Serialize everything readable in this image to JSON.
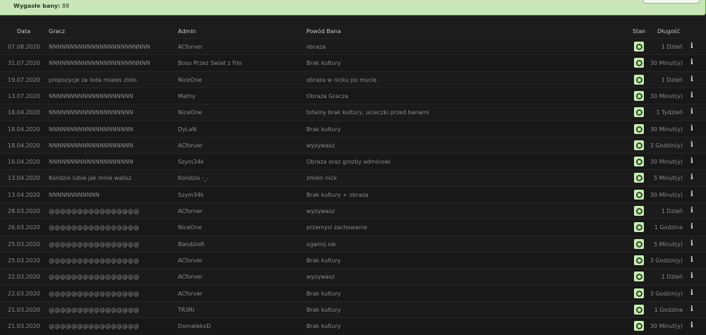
{
  "banner": {
    "label": "Wygasłe bany:",
    "count": "88"
  },
  "table": {
    "headers": {
      "date": "Data",
      "player": "Gracz",
      "admin": "Admin",
      "reason": "Powód Bana",
      "state": "Stan",
      "length": "Długość"
    },
    "rows": [
      {
        "date": "07.08.2020",
        "player": "NNNNNNNNNNNNNNNNNNNNNNNN",
        "admin": "ACforver",
        "reason": "obraza",
        "length": "1 Dzień"
      },
      {
        "date": "31.07.2020",
        "player": "NNNNNNNNNNNNNNNNNNNNNNNN",
        "admin": "Boso Przez Swiat z Filo",
        "reason": "Brak kultury",
        "length": "30 Minut(y)"
      },
      {
        "date": "19.07.2020",
        "player": "propozycje za loda miales zielo",
        "admin": "NiceOne",
        "reason": "obraza w nicku po mucie",
        "length": "1 Dzień"
      },
      {
        "date": "13.07.2020",
        "player": "NNNNNNNNNNNNNNNNNNNN",
        "admin": "Mathy",
        "reason": "Obraza Gracza",
        "length": "30 Minut(y)"
      },
      {
        "date": "18.04.2020",
        "player": "NNNNNNNNNNNNNNNNNNNN",
        "admin": "NiceOne",
        "reason": "totalny brak kultury, ucieczki przed banami",
        "length": "1 Tydzień"
      },
      {
        "date": "18.04.2020",
        "player": "NNNNNNNNNNNNNNNNNNNN",
        "admin": "DyLaN",
        "reason": "Brak kultury",
        "length": "30 Minut(y)"
      },
      {
        "date": "18.04.2020",
        "player": "NNNNNNNNNNNNNNNNNNNN",
        "admin": "ACforver",
        "reason": "wyzywasz",
        "length": "3 Godzin(y)"
      },
      {
        "date": "16.04.2020",
        "player": "NNNNNNNNNNNNNNNNNNNN",
        "admin": "Szym34k",
        "reason": "Obraza oraz grozby adminowi",
        "length": "30 Minut(y)"
      },
      {
        "date": "13.04.2020",
        "player": "Kondzio lubie jak mnie walisz",
        "admin": "Kondzio -_-",
        "reason": "zmien nick",
        "length": "5 Minut(y)"
      },
      {
        "date": "13.04.2020",
        "player": "NNNNNNNNNNNN",
        "admin": "Szym34k",
        "reason": "Brak kultury + obraza",
        "length": "30 Minut(y)"
      },
      {
        "date": "28.03.2020",
        "player": "@@@@@@@@@@@@@@@@",
        "admin": "ACforver",
        "reason": "wyzywasz",
        "length": "1 Dzień"
      },
      {
        "date": "26.03.2020",
        "player": "@@@@@@@@@@@@@@@@",
        "admin": "NiceOne",
        "reason": "przemysl zachowanie",
        "length": "1 Godzina"
      },
      {
        "date": "25.03.2020",
        "player": "@@@@@@@@@@@@@@@@",
        "admin": "BandzioR.",
        "reason": "ogarnij sie",
        "length": "5 Minut(y)"
      },
      {
        "date": "25.03.2020",
        "player": "@@@@@@@@@@@@@@@@",
        "admin": "ACforver",
        "reason": "Brak kultury",
        "length": "3 Godzin(y)"
      },
      {
        "date": "22.03.2020",
        "player": "@@@@@@@@@@@@@@@@",
        "admin": "ACforver",
        "reason": "wyzywasz",
        "length": "1 Dzień"
      },
      {
        "date": "22.03.2020",
        "player": "@@@@@@@@@@@@@@@@",
        "admin": "ACforver",
        "reason": "Brak kultury",
        "length": "3 Godzin(y)"
      },
      {
        "date": "21.03.2020",
        "player": "@@@@@@@@@@@@@@@@",
        "admin": "TR3RI",
        "reason": "Brak kultury",
        "length": "1 Godzina"
      },
      {
        "date": "21.03.2020",
        "player": "@@@@@@@@@@@@@@@@",
        "admin": "DomalekxD",
        "reason": "Brak kultury",
        "length": "30 Minut(y)"
      }
    ]
  },
  "icons": {
    "state": "circle-icon",
    "info": "info-icon"
  },
  "colors": {
    "banner_bg": "#c9e6b9",
    "state_badge": "#c7ecb2",
    "page_bg": "#1c1c1c"
  }
}
